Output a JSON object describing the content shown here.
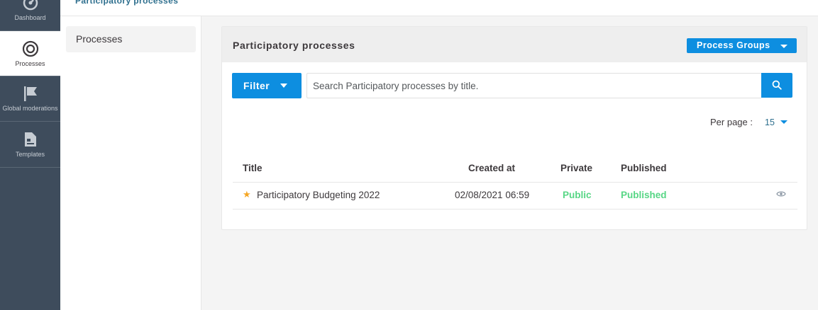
{
  "header": {
    "title": "Participatory processes"
  },
  "leftnav": {
    "items": [
      {
        "label": "Dashboard",
        "icon": "dashboard-icon",
        "active": false
      },
      {
        "label": "Processes",
        "icon": "target-icon",
        "active": true
      },
      {
        "label": "Global moderations",
        "icon": "flag-icon",
        "active": false
      },
      {
        "label": "Templates",
        "icon": "template-icon",
        "active": false
      }
    ]
  },
  "subnav": {
    "items": [
      {
        "label": "Processes"
      }
    ]
  },
  "card": {
    "title": "Participatory processes",
    "process_groups_label": "Process Groups",
    "filter_label": "Filter",
    "search": {
      "placeholder": "Search Participatory processes by title.",
      "value": ""
    },
    "per_page": {
      "label": "Per page :",
      "value": "15"
    },
    "table": {
      "columns": [
        "Title",
        "Created at",
        "Private",
        "Published"
      ],
      "rows": [
        {
          "title": "Participatory Budgeting 2022",
          "created_at": "02/08/2021 06:59",
          "private": "Public",
          "published": "Published",
          "promoted": true
        }
      ]
    }
  },
  "colors": {
    "accent": "#0d8ee0",
    "nav_bg": "#3e4c5c",
    "success": "#57d685",
    "star": "#f5a623",
    "header_link": "#2e6f8e"
  }
}
